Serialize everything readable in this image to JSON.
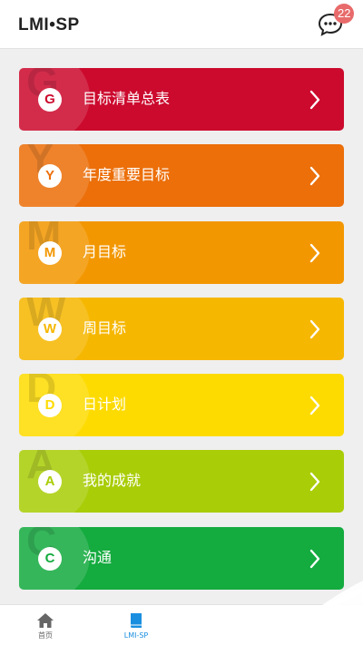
{
  "header": {
    "title": "LMI•SP",
    "message_icon": "speech-bubble-icon",
    "message_count": "22"
  },
  "cards": [
    {
      "letter": "G",
      "label": "目标清单总表",
      "color": "#cc0a2e"
    },
    {
      "letter": "Y",
      "label": "年度重要目标",
      "color": "#ec6f0a"
    },
    {
      "letter": "M",
      "label": "月目标",
      "color": "#f39700"
    },
    {
      "letter": "W",
      "label": "周目标",
      "color": "#f6b700"
    },
    {
      "letter": "D",
      "label": "日计划",
      "color": "#fedb00"
    },
    {
      "letter": "A",
      "label": "我的成就",
      "color": "#a9cd07"
    },
    {
      "letter": "C",
      "label": "沟通",
      "color": "#14ab3f"
    }
  ],
  "tabbar": {
    "home": {
      "label": "首页",
      "icon": "home-icon",
      "color": "#666666"
    },
    "lmisp": {
      "label": "LMI-SP",
      "icon": "book-icon",
      "color": "#1a8fe0"
    }
  }
}
